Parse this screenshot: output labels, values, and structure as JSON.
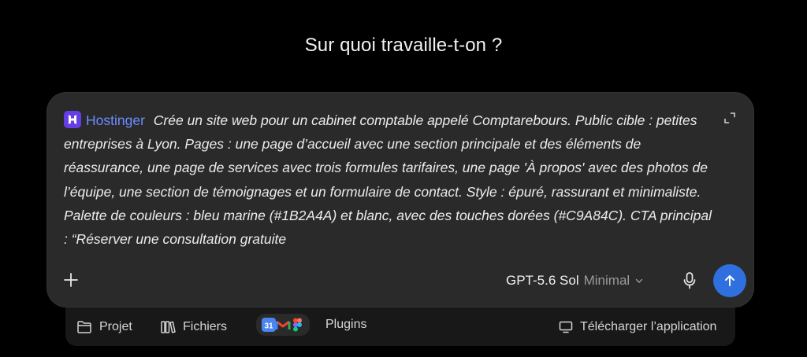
{
  "headline": "Sur quoi travaille-t-on ?",
  "composer": {
    "chip": {
      "label": "Hostinger",
      "icon": "hostinger-logo-icon",
      "color": "#6b8dff",
      "logo_color": "#673de6"
    },
    "prompt_text": "Crée un site web pour un cabinet comptable appelé Comptarebours. Public cible : petites entreprises à Lyon. Pages : une page d’accueil avec une section principale et des éléments de réassurance, une page de services avec trois formules tarifaires, une page 'À propos' avec des photos de l’équipe, une section de témoignages et un formulaire de contact. Style : épuré, rassurant et minimaliste. Palette de couleurs : bleu marine (#1B2A4A) et blanc, avec des touches dorées (#C9A84C). CTA principal : “Réserver une consultation gratuite",
    "model": {
      "name": "GPT-5.6 Sol",
      "mode": "Minimal"
    },
    "send_button_color": "#2f6fde"
  },
  "bottom_bar": {
    "project_label": "Projet",
    "files_label": "Fichiers",
    "plugins_label": "Plugins",
    "calendar_day": "31",
    "download_label": "Télécharger l’application"
  }
}
